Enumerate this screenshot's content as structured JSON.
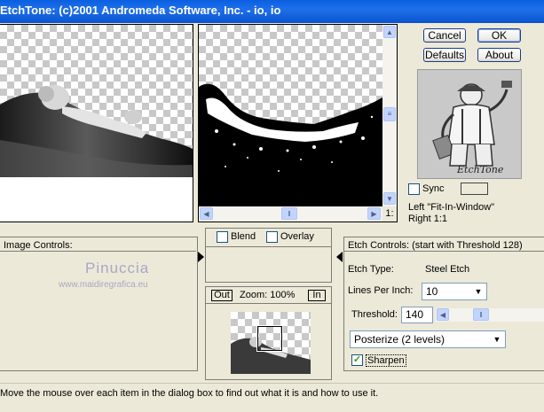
{
  "title": "EtchTone: (c)2001 Andromeda Software, Inc. - io, io",
  "buttons": {
    "cancel": "Cancel",
    "ok": "OK",
    "defaults": "Defaults",
    "about": "About"
  },
  "logo_caption": "EtchTone",
  "sync_label": "Sync",
  "left_info": "Left \"Fit-In-Window\"",
  "right_info": "Right 1:1",
  "ratio_label": "1:",
  "image_controls_label": "Image Controls:",
  "watermark": {
    "name": "Pinuccia",
    "url": "www.maidiregrafica.eu"
  },
  "blend_label": "Blend",
  "overlay_label": "Overlay",
  "zoom": {
    "out": "Out",
    "label": "Zoom: 100%",
    "in": "In"
  },
  "etch": {
    "header": "Etch Controls: (start with Threshold 128)",
    "type_label": "Etch Type:",
    "type_value": "Steel Etch",
    "lpi_label": "Lines Per Inch:",
    "lpi_value": "10",
    "threshold_label": "Threshold:",
    "threshold_value": "140",
    "posterize_value": "Posterize (2 levels)",
    "sharpen_label": "Sharpen",
    "sharpen_checked": true
  },
  "status": "Move the mouse over each item in the dialog box to find out what it is and how to use it."
}
